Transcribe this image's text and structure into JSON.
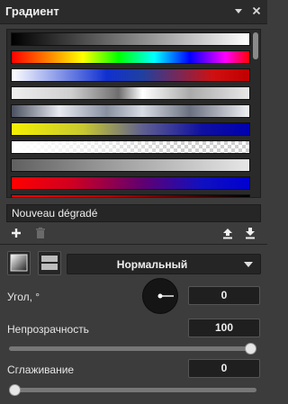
{
  "header": {
    "title": "Градиент",
    "menu_icon": "menu-down-icon",
    "close_icon": "close-icon"
  },
  "gradients": [
    {
      "name": "black-white",
      "css": "linear-gradient(90deg,#000 0%,#fff 100%)"
    },
    {
      "name": "spectrum",
      "css": "linear-gradient(90deg,#ff0000 0%,#ff7f00 15%,#ffff00 30%,#00ff00 45%,#00ffff 60%,#0000ff 75%,#ff00ff 90%,#ff0000 100%)"
    },
    {
      "name": "white-blue-red",
      "css": "linear-gradient(90deg,#fff 0%,#1030d0 40%,#2040a0 55%,#d01010 85%,#c00000 100%)"
    },
    {
      "name": "silver",
      "css": "linear-gradient(90deg,#eeeeee 0%,#cfcfcf 25%,#6e6e6e 45%,#ffffff 55%,#aaaaaa 75%,#e8e8e8 100%)"
    },
    {
      "name": "steel",
      "css": "linear-gradient(90deg,#4a5060 0%,#e8eaf0 20%,#8890a0 40%,#d8dce4 55%,#6a7080 75%,#f0f0f4 100%)"
    },
    {
      "name": "yellow-blue",
      "css": "linear-gradient(90deg,#f5f000 0%,#c8c830 30%,#606090 55%,#1010a0 80%,#0000b0 100%)"
    },
    {
      "name": "white-transparent",
      "css": "linear-gradient(90deg,#ffffff 0%,rgba(255,255,255,0.5) 40%,rgba(255,255,255,0) 70%),repeating-conic-gradient(#cfcfcf 0% 25%,#ffffff 0% 50%) 0 0/8px 8px"
    },
    {
      "name": "gray-white",
      "css": "linear-gradient(90deg,#606060 0%,#9a9a9a 40%,#e6e6e6 100%)"
    },
    {
      "name": "red-blue",
      "css": "linear-gradient(90deg,#ff0000 0%,#d00020 25%,#600070 55%,#1010c0 80%,#0000d0 100%)"
    },
    {
      "name": "red-black",
      "css": "linear-gradient(90deg,#ff0000 0%,#c00000 40%,#400000 80%,#000 100%)"
    }
  ],
  "gradient_name": "Nouveau dégradé",
  "actions": {
    "add_icon": "plus-icon",
    "delete_icon": "trash-icon",
    "import_icon": "upload-icon",
    "export_icon": "download-icon"
  },
  "type_buttons": [
    {
      "name": "linear-gradient-type",
      "active": true
    },
    {
      "name": "radial-gradient-type",
      "active": false
    }
  ],
  "blend_mode": {
    "value": "Нормальный"
  },
  "angle": {
    "label": "Угол, °",
    "value": "0"
  },
  "opacity": {
    "label": "Непрозрачность",
    "value": "100",
    "fraction": 1.0
  },
  "smoothing": {
    "label": "Сглаживание",
    "value": "0",
    "fraction": 0.0
  },
  "colors": {
    "panel_bg": "#3c3c3c",
    "title_bg": "#2b2b2b",
    "field_bg": "#1f1f1f",
    "text": "#e6e6e6"
  }
}
